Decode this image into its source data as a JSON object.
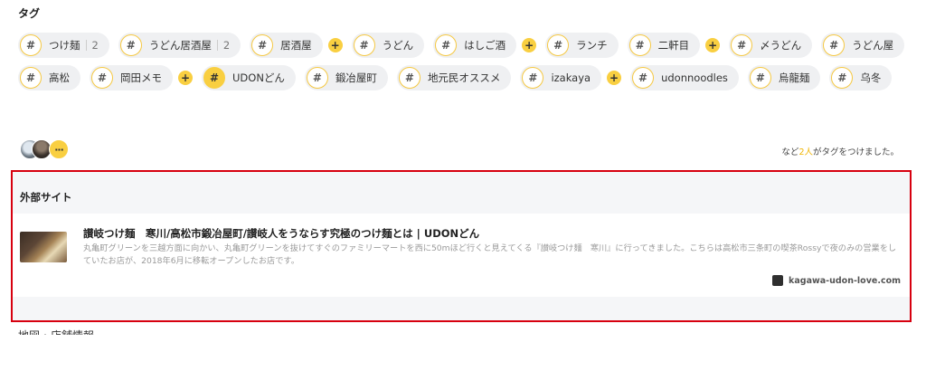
{
  "tags_section": {
    "title": "タグ",
    "tags": [
      {
        "label": "つけ麺",
        "count": "2",
        "plus": false,
        "selected": false
      },
      {
        "label": "うどん居酒屋",
        "count": "2",
        "plus": false,
        "selected": false
      },
      {
        "label": "居酒屋",
        "count": "",
        "plus": true,
        "selected": false
      },
      {
        "label": "うどん",
        "count": "",
        "plus": false,
        "selected": false
      },
      {
        "label": "はしご酒",
        "count": "",
        "plus": true,
        "selected": false
      },
      {
        "label": "ランチ",
        "count": "",
        "plus": false,
        "selected": false
      },
      {
        "label": "二軒目",
        "count": "",
        "plus": true,
        "selected": false
      },
      {
        "label": "〆うどん",
        "count": "",
        "plus": false,
        "selected": false
      },
      {
        "label": "うどん屋",
        "count": "",
        "plus": false,
        "selected": false
      },
      {
        "label": "高松",
        "count": "",
        "plus": false,
        "selected": false
      },
      {
        "label": "岡田メモ",
        "count": "",
        "plus": true,
        "selected": false
      },
      {
        "label": "UDONどん",
        "count": "",
        "plus": false,
        "selected": true
      },
      {
        "label": "鍛冶屋町",
        "count": "",
        "plus": false,
        "selected": false
      },
      {
        "label": "地元民オススメ",
        "count": "",
        "plus": false,
        "selected": false
      },
      {
        "label": "izakaya",
        "count": "",
        "plus": true,
        "selected": false
      },
      {
        "label": "udonnoodles",
        "count": "",
        "plus": false,
        "selected": false
      },
      {
        "label": "烏龍麺",
        "count": "",
        "plus": false,
        "selected": false
      },
      {
        "label": "乌冬",
        "count": "",
        "plus": false,
        "selected": false
      }
    ],
    "hash_symbol": "#",
    "plus_symbol": "+",
    "more_avatars": "···",
    "tagged_note_prefix": "など",
    "tagged_note_count": "2人",
    "tagged_note_suffix": "がタグをつけました。"
  },
  "external_sites": {
    "title": "外部サイト",
    "card": {
      "title": "讃岐つけ麺　寒川/高松市鍛冶屋町/讃岐人をうならす究極のつけ麺とは | UDONどん",
      "description": "丸亀町グリーンを三越方面に向かい、丸亀町グリーンを抜けてすぐのファミリーマートを西に50mほど行くと見えてくる『讃岐つけ麺　寒川』に行ってきました。こちらは高松市三条町の喫茶Rossyで夜のみの営業をしていたお店が、2018年6月に移転オープンしたお店です。",
      "domain": "kagawa-udon-love.com"
    }
  },
  "next_section_partial": "地図・店舗情報"
}
